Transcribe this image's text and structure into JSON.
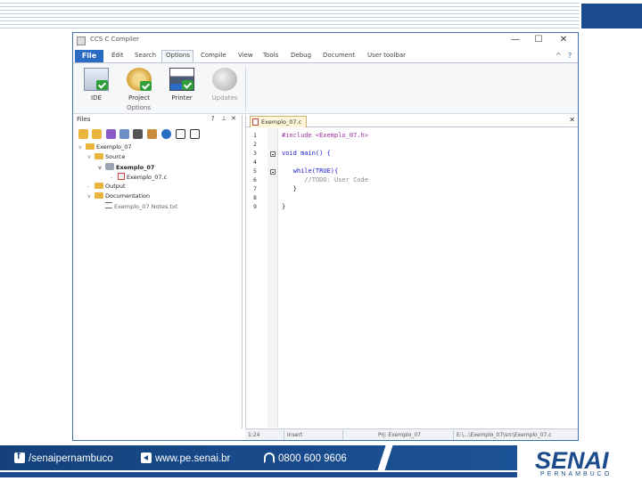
{
  "window": {
    "title": "CCS C Compiler",
    "controls": {
      "minimize": "—",
      "maximize": "☐",
      "close": "✕"
    }
  },
  "menu": {
    "file": "File",
    "items": [
      "Edit",
      "Search",
      "Options",
      "Compile",
      "View",
      "Tools",
      "Debug",
      "Document",
      "User toolbar"
    ],
    "active": "Options",
    "right_icons": [
      "^",
      "?"
    ]
  },
  "ribbon": {
    "buttons": [
      {
        "label": "IDE",
        "icon": "ide-icon"
      },
      {
        "label": "Project",
        "icon": "project-gear-icon"
      },
      {
        "label": "Printer",
        "icon": "printer-icon"
      },
      {
        "label": "Updates",
        "icon": "globe-update-icon"
      }
    ],
    "group_label": "Options"
  },
  "files_panel": {
    "title": "Files",
    "controls": [
      "?",
      "⊥",
      "✕"
    ],
    "toolbar_icons": [
      "open-folder-icon",
      "close-folder-icon",
      "save-icon",
      "attach-icon",
      "link-icon",
      "build-icon",
      "info-icon",
      "expand-icon",
      "collapse-icon"
    ],
    "tree": [
      {
        "label": "Exemplo_07",
        "type": "folder",
        "toggle": "v",
        "indent": 0
      },
      {
        "label": "Source",
        "type": "folder",
        "toggle": "v",
        "indent": 1
      },
      {
        "label": "Exemplo_07",
        "type": "project",
        "toggle": "v",
        "indent": 2
      },
      {
        "label": "Exemplo_07.c",
        "type": "cfile",
        "toggle": "-",
        "indent": 3
      },
      {
        "label": "Output",
        "type": "folder",
        "toggle": "-",
        "indent": 1
      },
      {
        "label": "Documentation",
        "type": "folder",
        "toggle": "v",
        "indent": 1
      },
      {
        "label": "Exemplo_07 Notes.txt",
        "type": "text",
        "toggle": "",
        "indent": 2
      }
    ]
  },
  "editor": {
    "tab_label": "Exemplo_07.c",
    "close": "✕",
    "line_numbers": [
      "1",
      "2",
      "3",
      "4",
      "5",
      "6",
      "7",
      "8",
      "9"
    ],
    "lines": [
      {
        "n": 1,
        "text": "#include <Exemplo_07.h>",
        "style": "inc"
      },
      {
        "n": 2,
        "text": "",
        "style": ""
      },
      {
        "n": 3,
        "text": "void main() {",
        "style": "kw"
      },
      {
        "n": 4,
        "text": "",
        "style": ""
      },
      {
        "n": 5,
        "text": "   while(TRUE){",
        "style": "kw"
      },
      {
        "n": 6,
        "text": "      //TODO: User Code",
        "style": "com"
      },
      {
        "n": 7,
        "text": "   }",
        "style": ""
      },
      {
        "n": 8,
        "text": "",
        "style": ""
      },
      {
        "n": 9,
        "text": "}",
        "style": ""
      }
    ]
  },
  "status_bar": {
    "position": "1:24",
    "mode": "Insert",
    "project": "Prj: Exemplo_07",
    "path": "E:\\...\\Exemplo_07\\src\\Exemplo_07.c"
  },
  "footer": {
    "facebook": "/senaipernambuco",
    "website": "www.pe.senai.br",
    "phone": "0800 600 9606",
    "logo": "SENAI",
    "logo_sub": "PERNAMBUCO"
  },
  "colors": {
    "accent": "#2a6cc4",
    "brand_blue": "#1b4b8c",
    "check_green": "#2f9d3a"
  }
}
